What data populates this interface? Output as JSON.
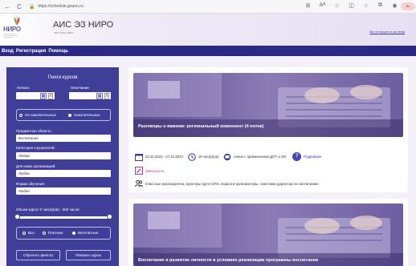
{
  "browser": {
    "back": "←",
    "reload": "C",
    "lock": "🔒",
    "url": "https://schedule.gounn.ru",
    "toolbar_icons": [
      "grid-icon",
      "aa-icon",
      "star-icon",
      "split-icon",
      "favorites-icon",
      "collections-icon",
      "profile-icon"
    ],
    "toolbar_glyphs": [
      "⊞",
      "Aᴬ",
      "☆",
      "◫",
      "☆",
      "⧉",
      "◉"
    ],
    "profile_label": "Вх"
  },
  "header": {
    "logo_text": "НИРО",
    "logo_sub": "Нижегородский институт развития образования",
    "title": "АИС ЭЗ НИРО",
    "subtitle": "ГБОУ ДПО НИРО",
    "login_link": "Вы не вошли в систему"
  },
  "nav": {
    "items": [
      "Вход",
      "Регистрация",
      "Помощь"
    ]
  },
  "sidebar": {
    "title": "Поиск курсов",
    "start_label": "Начало",
    "end_label": "Окончание",
    "cal_glyph": "▦",
    "x_glyph": "X",
    "accumulation_options": [
      "Не накопительные",
      "Накопительные"
    ],
    "accumulation_selected": 1,
    "subject_label": "Предметная область:",
    "subject_value": "Воспитание",
    "category_label": "Категория слушателей:",
    "category_value": "Любая",
    "org_label": "Для каких организаций:",
    "org_value": "Любая",
    "form_label": "Форма обучения:",
    "form_value": "Любая",
    "volume_label": "Объем курса: 0 час(а)(ов) - 300 часов",
    "volume_min": 0,
    "volume_max": 300,
    "payment_options": [
      "Все",
      "Платные",
      "Бесплатные"
    ],
    "payment_selected": 2,
    "reset_button": "Сбросить фильтр",
    "show_button": "Показать курсы"
  },
  "courses": [
    {
      "title": "Разговоры о важном: региональный компонент (4 поток)",
      "dates": "23.10.2023 - 27.10.2023",
      "hours": "18 час(а)(ов)",
      "format": "очное с применением ДОТ и ЭО",
      "details_link": "Подробнее",
      "enroll_link": "Записаться",
      "audience": "Классные руководители, кураторы групп СПО, педагоги-организаторы, советники директора по воспитанию"
    },
    {
      "title": "Воспитание и развитие личности в условиях реализации программы воспитания"
    }
  ],
  "colors": {
    "nav": "#2a2a86",
    "sidebar": "#3f3f99",
    "accent_pink": "#c0398a",
    "help": "#4b44b8"
  }
}
